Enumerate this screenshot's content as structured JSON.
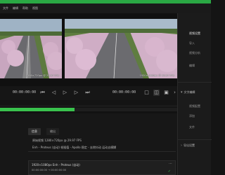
{
  "app": {
    "menubar": [
      "文件",
      "编辑",
      "帮助",
      "视图"
    ]
  },
  "viewer": {
    "left_caption": "1280×720px @ 29.97 FPS",
    "right_caption": "1920×1080px @ 29.97 FPS"
  },
  "toolbar": {
    "timecode_left": "00:00:00:00",
    "timecode_right": "00:00:00:00"
  },
  "sidebar": {
    "items": [
      "视频设置",
      "导入",
      "视频分析",
      "编辑"
    ],
    "section1": "文字编辑",
    "section1_items": [
      "视频配置",
      "添加",
      "文件"
    ],
    "section2": "导出设置"
  },
  "progress": {
    "percent": 0.42
  },
  "bottom": {
    "tabs": [
      "信息",
      "输出"
    ],
    "source_info": "原始视频 1280×720px @ 29.97 FPS",
    "profile_line": "Enh - Proteus (自动)   帧插值 - Apollo   稳定 - 去除抖动   运动去模糊",
    "card_title": "1920×1080px   Enh - Proteus (自动)",
    "card_row1": "00:00:00:00 → 00:00:00:00",
    "card_row2": "00:00:00:00 → 00:00:00:00"
  },
  "colors": {
    "accent": "#39c24d",
    "topstrip": "#2aa844"
  }
}
